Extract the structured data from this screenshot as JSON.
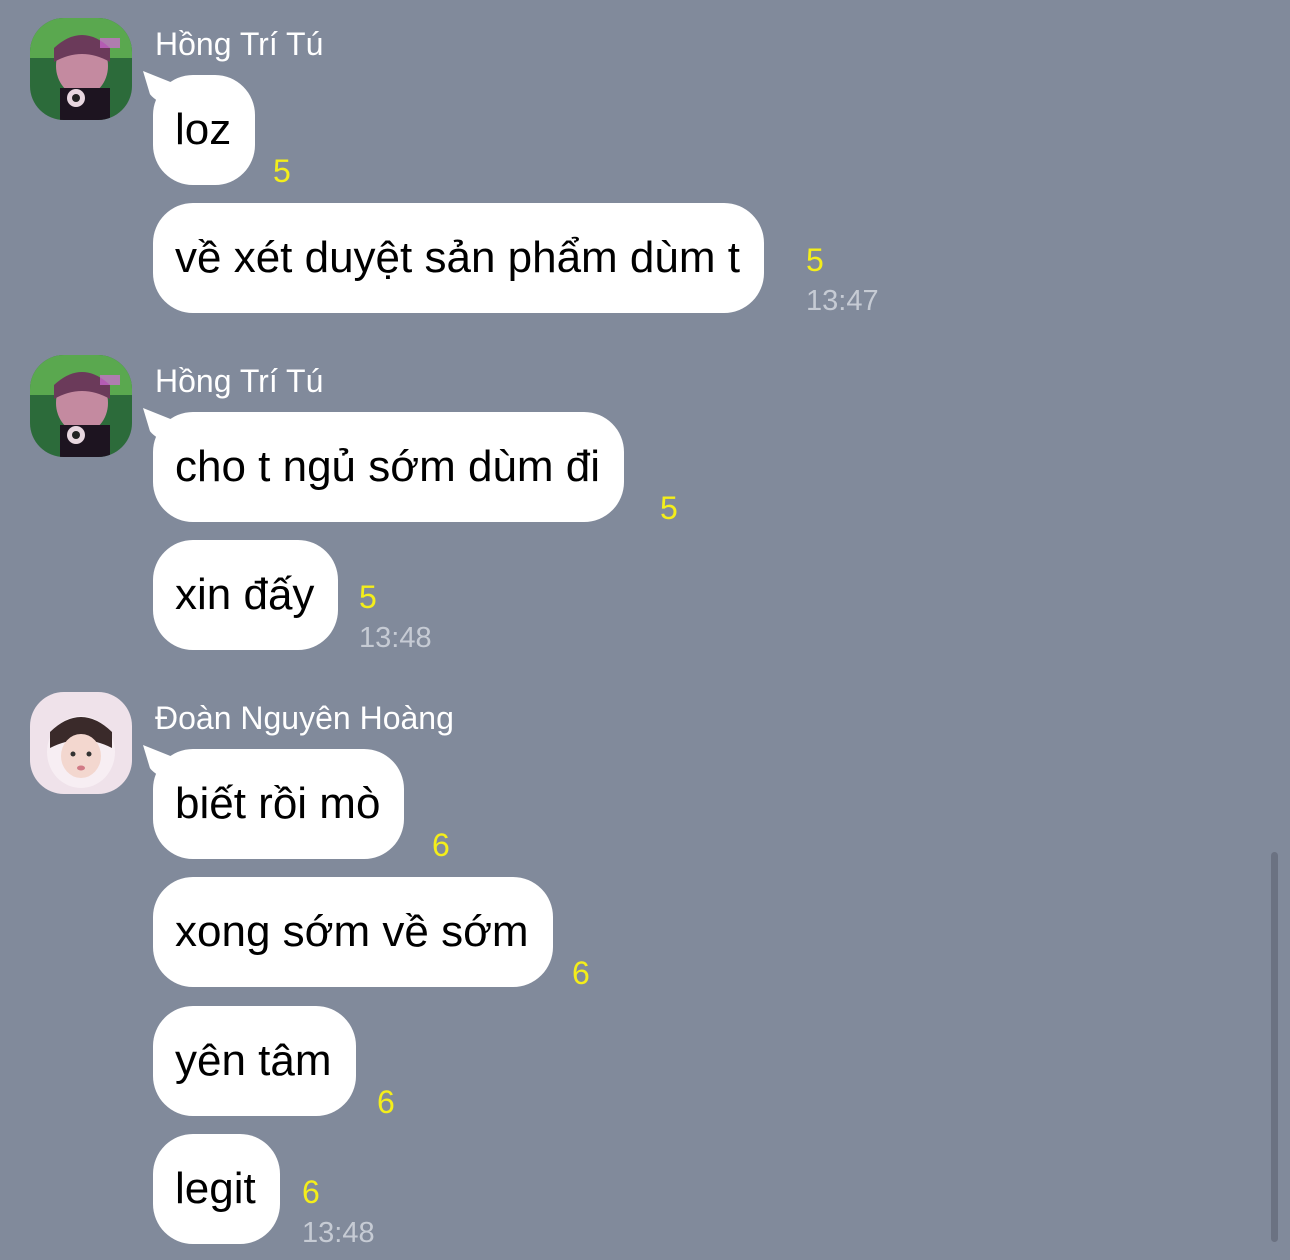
{
  "groups": [
    {
      "sender": "Hồng Trí Tú",
      "avatar_icon": "user-photo-avatar",
      "messages": [
        {
          "text": "loz",
          "read_count": "5"
        },
        {
          "text": "về xét duyệt sản phẩm dùm t",
          "read_count": "5",
          "time": "13:47"
        }
      ]
    },
    {
      "sender": "Hồng Trí Tú",
      "avatar_icon": "user-photo-avatar",
      "messages": [
        {
          "text": "cho t ngủ sớm dùm đi",
          "read_count": "5"
        },
        {
          "text": "xin đấy",
          "read_count": "5",
          "time": "13:48"
        }
      ]
    },
    {
      "sender": "Đoàn Nguyên Hoàng",
      "avatar_icon": "user-photo-avatar",
      "messages": [
        {
          "text": "biết rồi mò",
          "read_count": "6"
        },
        {
          "text": "xong sớm về sớm",
          "read_count": "6"
        },
        {
          "text": "yên tâm",
          "read_count": "6"
        },
        {
          "text": "legit",
          "read_count": "6",
          "time": "13:48"
        }
      ]
    }
  ],
  "colors": {
    "background": "#818a9b",
    "bubble": "#ffffff",
    "read_count": "#f4ee1a",
    "timestamp": "#c6cbd4"
  }
}
